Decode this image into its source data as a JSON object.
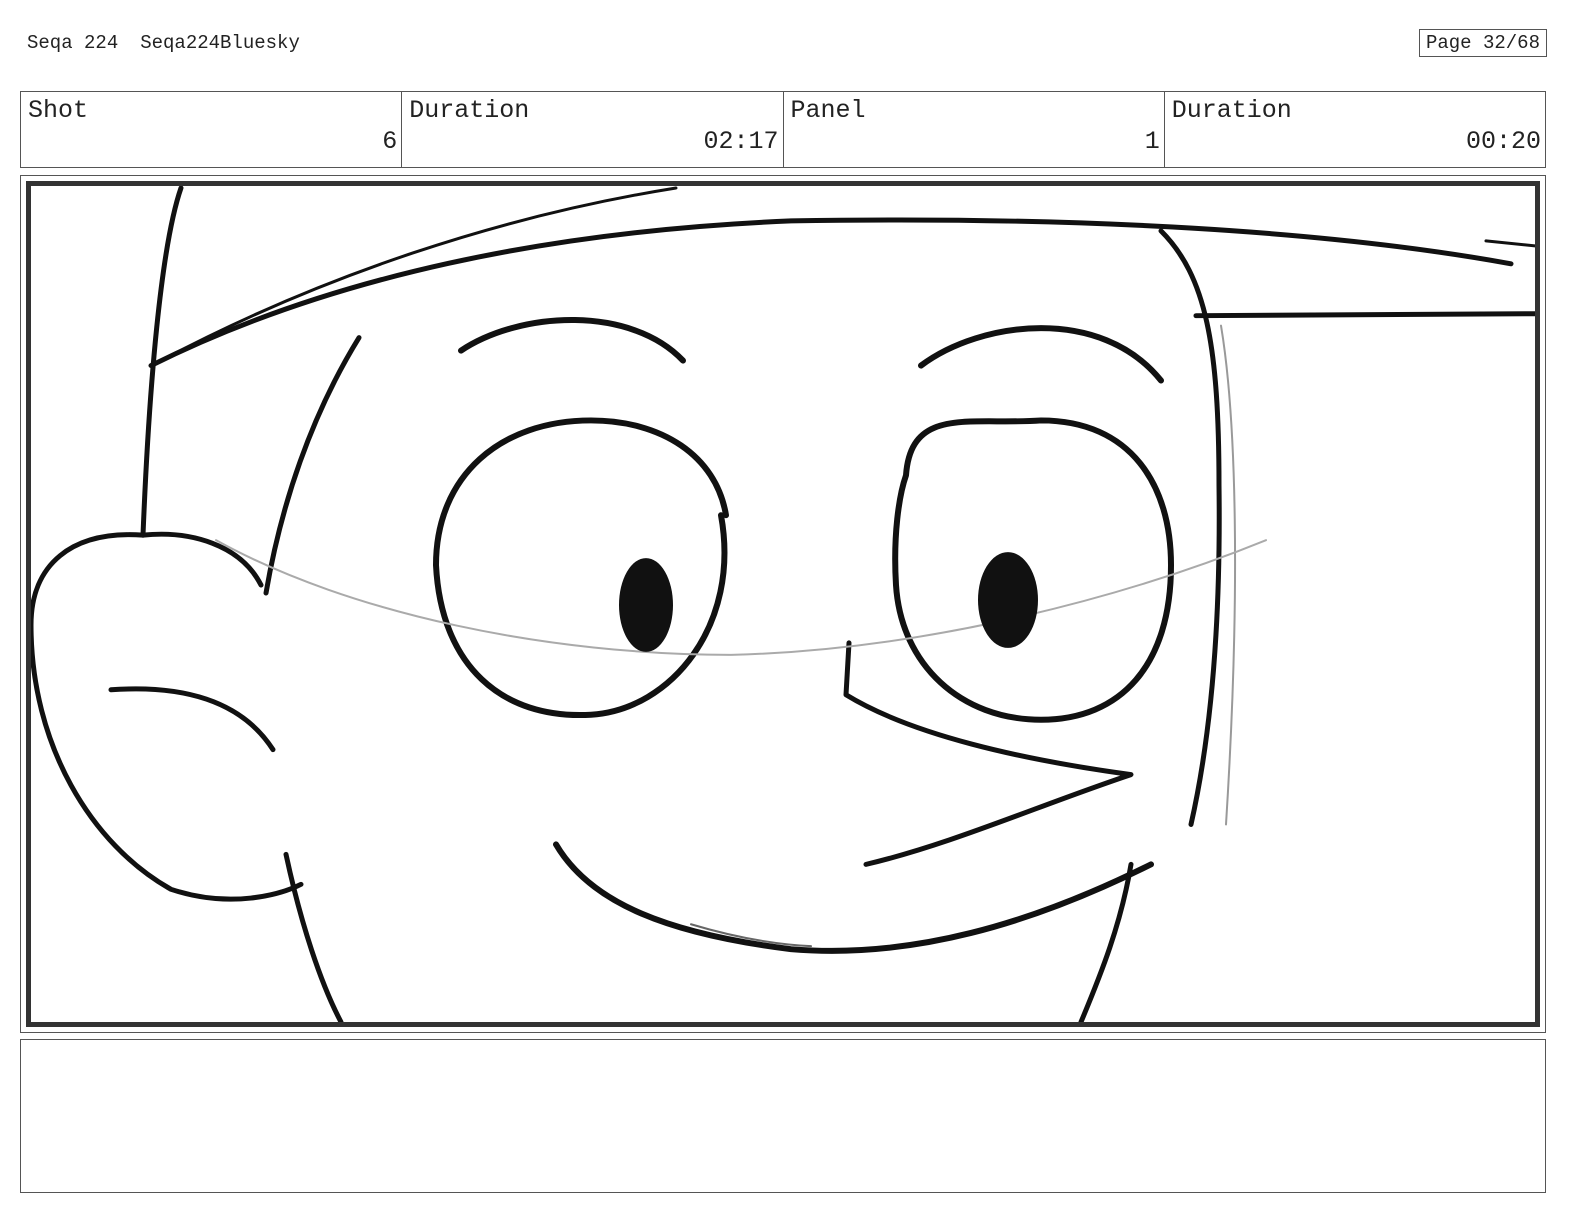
{
  "header": {
    "sequence": "Seqa 224",
    "sequence_name": "Seqa224Bluesky",
    "page": "Page 32/68"
  },
  "info": {
    "shot_label": "Shot",
    "shot_value": "6",
    "shot_duration_label": "Duration",
    "shot_duration_value": "02:17",
    "panel_label": "Panel",
    "panel_value": "1",
    "panel_duration_label": "Duration",
    "panel_duration_value": "00:20"
  },
  "notes": {
    "text": ""
  }
}
